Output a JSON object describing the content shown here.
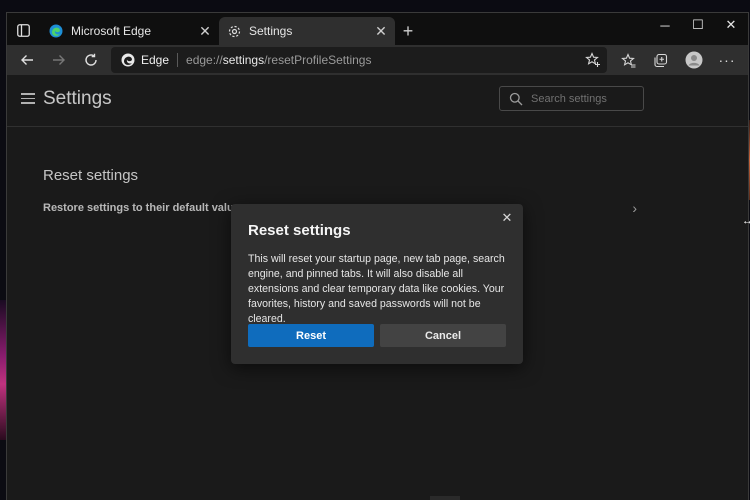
{
  "browser": {
    "tabs": [
      {
        "label": "Microsoft Edge",
        "icon": "edge-icon",
        "active": false
      },
      {
        "label": "Settings",
        "icon": "gear-icon",
        "active": true
      }
    ],
    "address": {
      "site_label": "Edge",
      "url_prefix": "edge://",
      "url_host": "settings",
      "url_path": "/resetProfileSettings"
    }
  },
  "settings": {
    "title": "Settings",
    "search_placeholder": "Search settings",
    "section_title": "Reset settings",
    "restore_item": "Restore settings to their default values"
  },
  "dialog": {
    "title": "Reset settings",
    "body": "This will reset your startup page, new tab page, search engine, and pinned tabs. It will also disable all extensions and clear temporary data like cookies. Your favorites, history and saved passwords will not be cleared.",
    "reset_label": "Reset",
    "cancel_label": "Cancel"
  },
  "colors": {
    "accent": "#0f6cbd",
    "window_bg": "#202020",
    "dialog_bg": "#2f2f2f"
  }
}
